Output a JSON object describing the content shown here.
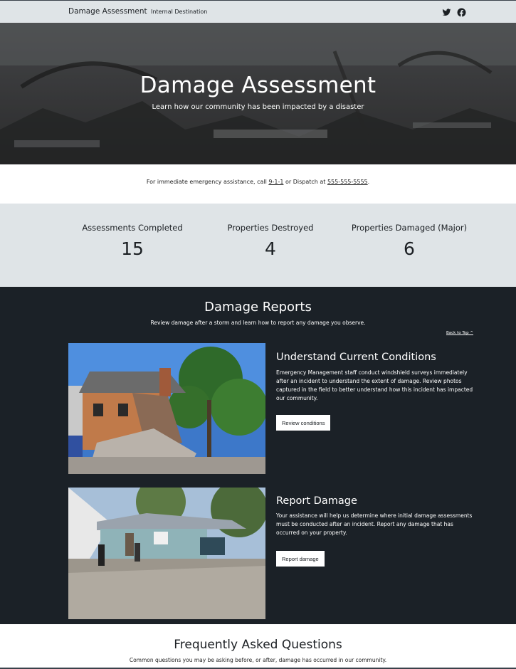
{
  "nav": {
    "brand": "Damage Assessment",
    "link": "Internal Destination",
    "social": [
      "twitter-icon",
      "facebook-icon"
    ]
  },
  "hero": {
    "title": "Damage Assessment",
    "subtitle": "Learn how our community has been impacted by a disaster"
  },
  "emergency": {
    "prefix": "For immediate emergency assistance, call ",
    "phone1": "9-1-1",
    "middle": " or Dispatch at ",
    "phone2": "555-555-5555",
    "suffix": "."
  },
  "stats": [
    {
      "label": "Assessments Completed",
      "value": "15"
    },
    {
      "label": "Properties Destroyed",
      "value": "4"
    },
    {
      "label": "Properties Damaged (Major)",
      "value": "6"
    }
  ],
  "reports": {
    "title": "Damage Reports",
    "subtitle": "Review damage after a storm and learn how to report any damage you observe.",
    "back_to_top": "Back to Top ^",
    "cards": [
      {
        "title": "Understand Current Conditions",
        "text": "Emergency Management staff conduct windshield surveys immediately after an incident to understand the extent of damage. Review photos captured in the field to better understand how this incident has impacted our community.",
        "button": "Review conditions"
      },
      {
        "title": "Report Damage",
        "text": "Your assistance will help us determine where initial damage assessments must be conducted after an incident. Report any damage that has occurred on your property.",
        "button": "Report damage"
      }
    ]
  },
  "faq": {
    "title": "Frequently Asked Questions",
    "subtitle": "Common questions you may be asking before, or after, damage has occurred in our community."
  },
  "colors": {
    "light_band": "#dfe4e7",
    "dark_band": "#1b2127",
    "text_dark": "#1b1f23"
  }
}
